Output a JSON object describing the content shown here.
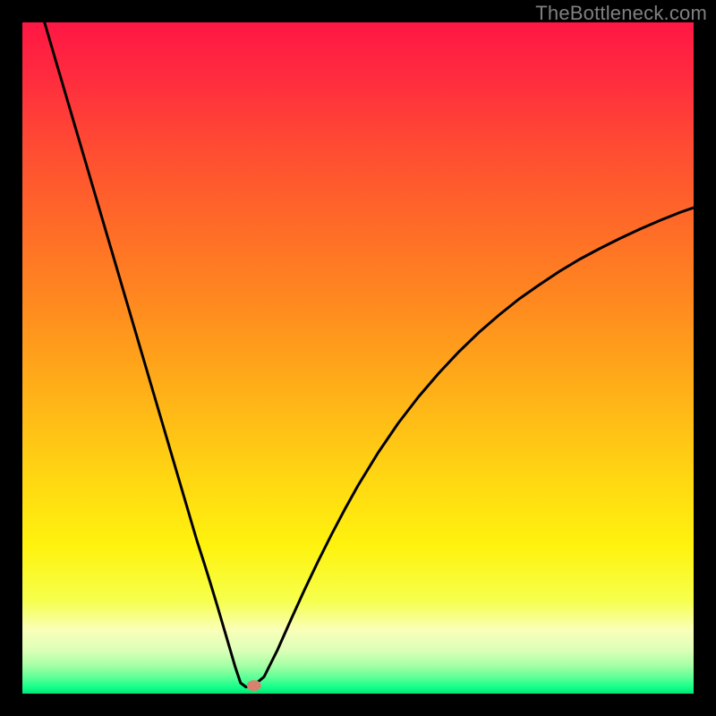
{
  "watermark": "TheBottleneck.com",
  "chart_data": {
    "type": "line",
    "title": "",
    "xlabel": "",
    "ylabel": "",
    "xlim": [
      0,
      100
    ],
    "ylim": [
      0,
      100
    ],
    "x": [
      3.3,
      5,
      7,
      9,
      11,
      13,
      15,
      17,
      19,
      21,
      23,
      25,
      26,
      27,
      28,
      29,
      30,
      31,
      31.7,
      32.5,
      33.3,
      34.2,
      36,
      38,
      40,
      42,
      44,
      46,
      48,
      50,
      53,
      56,
      59,
      62,
      65,
      68,
      71,
      74,
      77,
      80,
      83,
      86,
      89,
      92,
      95,
      98,
      100
    ],
    "values": [
      100,
      94.2,
      87.4,
      80.6,
      73.8,
      67.0,
      60.2,
      53.4,
      46.6,
      39.8,
      33.0,
      26.2,
      22.8,
      19.7,
      16.5,
      13.2,
      9.8,
      6.4,
      4.0,
      1.6,
      1.0,
      1.0,
      2.5,
      6.5,
      11.0,
      15.4,
      19.6,
      23.6,
      27.4,
      31.0,
      35.9,
      40.3,
      44.2,
      47.7,
      50.9,
      53.8,
      56.4,
      58.8,
      60.9,
      62.9,
      64.7,
      66.3,
      67.8,
      69.2,
      70.5,
      71.7,
      72.4
    ],
    "valley_floor": {
      "x_start": 31.7,
      "x_end": 34.2,
      "y": 1.0
    },
    "marker": {
      "x": 34.5,
      "y": 1.2,
      "color": "#d9816f"
    },
    "gradient_stops": [
      {
        "offset": 0.0,
        "color": "#ff1744"
      },
      {
        "offset": 0.08,
        "color": "#ff2b3f"
      },
      {
        "offset": 0.18,
        "color": "#ff4a33"
      },
      {
        "offset": 0.3,
        "color": "#ff6a28"
      },
      {
        "offset": 0.42,
        "color": "#ff8a1f"
      },
      {
        "offset": 0.55,
        "color": "#ffb018"
      },
      {
        "offset": 0.68,
        "color": "#ffd712"
      },
      {
        "offset": 0.78,
        "color": "#fff30e"
      },
      {
        "offset": 0.86,
        "color": "#f6ff4a"
      },
      {
        "offset": 0.905,
        "color": "#f9ffb8"
      },
      {
        "offset": 0.935,
        "color": "#ddffb8"
      },
      {
        "offset": 0.958,
        "color": "#a6ffa6"
      },
      {
        "offset": 0.975,
        "color": "#61ff97"
      },
      {
        "offset": 0.99,
        "color": "#17ff8a"
      },
      {
        "offset": 1.0,
        "color": "#00e676"
      }
    ],
    "background": "#000000",
    "curve_color": "#000000",
    "curve_width": 3
  }
}
